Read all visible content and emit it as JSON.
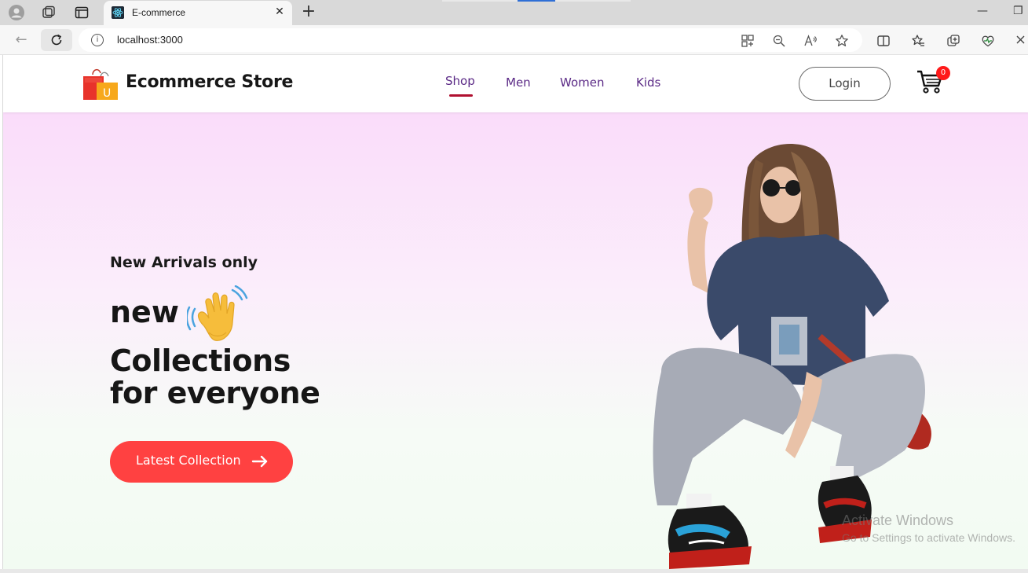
{
  "browser": {
    "tab_title": "E-commerce",
    "tab_close": "✕",
    "new_tab": "+",
    "url": "localhost:3000",
    "info_glyph": "i",
    "minimize": "—",
    "restore": "❐",
    "back_glyph": "←"
  },
  "navbar": {
    "brand": "Ecommerce Store",
    "logo_letter": "U",
    "menu": [
      "Shop",
      "Men",
      "Women",
      "Kids"
    ],
    "active_menu": "Shop",
    "login_label": "Login",
    "cart_count": "0"
  },
  "hero": {
    "tagline": "New Arrivals only",
    "headline_new": "new",
    "headline_line1": "Collections",
    "headline_line2": "for everyone",
    "cta_label": "Latest Collection"
  },
  "watermark": {
    "line1": "Activate Windows",
    "line2": "Go to Settings to activate Windows."
  },
  "colors": {
    "accent_red": "#ff4141",
    "menu_purple": "#5b2a86",
    "underline": "#b01030",
    "badge": "#ff1a1a"
  },
  "icons": [
    "profile-icon",
    "workspaces-icon",
    "tab-actions-icon",
    "react-favicon",
    "reload-icon",
    "info-icon",
    "apps-icon",
    "zoom-icon",
    "read-aloud-icon",
    "favorite-icon",
    "split-screen-icon",
    "favorites-icon",
    "collections-icon",
    "performance-icon",
    "shopping-bag-logo",
    "cart-icon",
    "waving-hand-icon",
    "arrow-right-icon"
  ]
}
